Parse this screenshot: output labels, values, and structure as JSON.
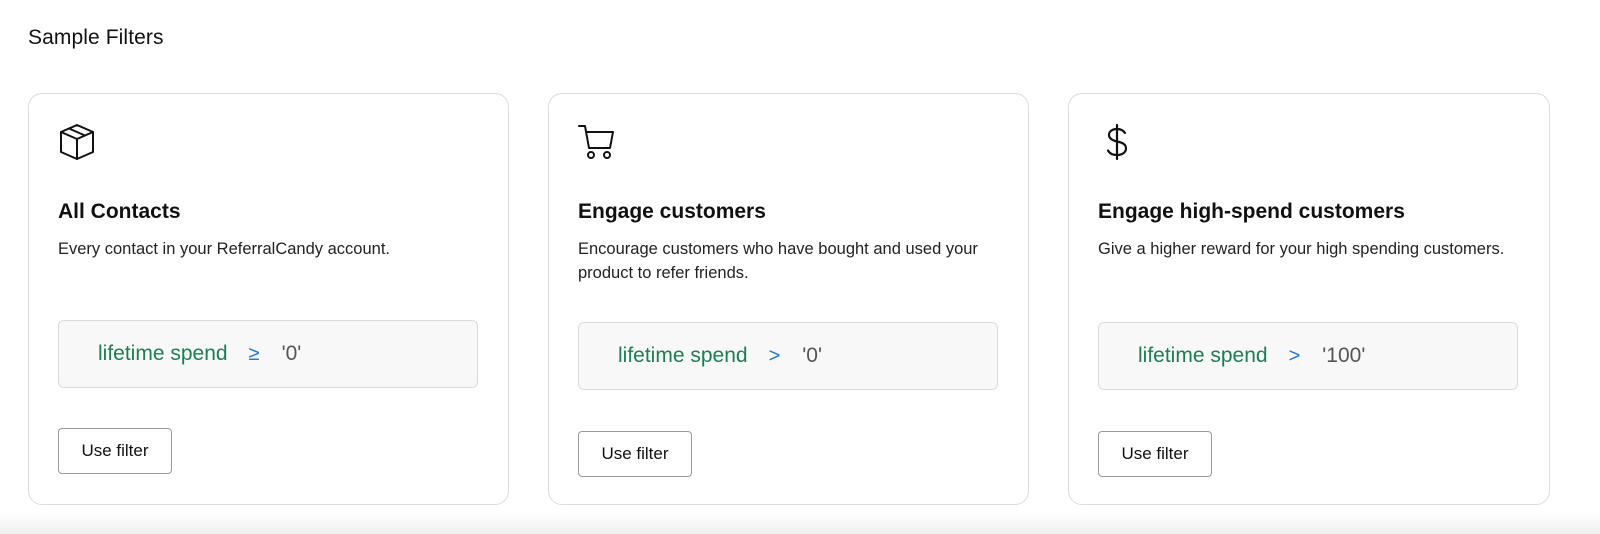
{
  "section": {
    "title": "Sample Filters"
  },
  "cards": [
    {
      "icon": "box-icon",
      "title": "All Contacts",
      "description": "Every contact in your ReferralCandy account.",
      "filter": {
        "field": "lifetime spend",
        "operator": "≥",
        "value": "'0'"
      },
      "button_label": "Use filter"
    },
    {
      "icon": "shopping-cart-icon",
      "title": "Engage customers",
      "description": "Encourage customers who have bought and used your product to refer friends.",
      "filter": {
        "field": "lifetime spend",
        "operator": ">",
        "value": "'0'"
      },
      "button_label": "Use filter"
    },
    {
      "icon": "dollar-sign-icon",
      "title": "Engage high-spend customers",
      "description": "Give a higher reward for your high spending customers.",
      "filter": {
        "field": "lifetime spend",
        "operator": ">",
        "value": "'100'"
      },
      "button_label": "Use filter"
    }
  ],
  "colors": {
    "filter_field": "#1a7f52",
    "filter_operator": "#1a73e8",
    "filter_value": "#555555",
    "card_border": "#dcdcdc",
    "filter_background": "#f8f8f8"
  }
}
